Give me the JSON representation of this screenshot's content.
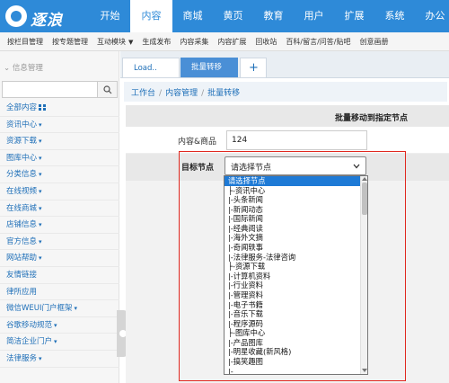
{
  "logo": {
    "text": "逐浪"
  },
  "topnav": [
    {
      "label": "开始"
    },
    {
      "label": "内容"
    },
    {
      "label": "商城"
    },
    {
      "label": "黄页"
    },
    {
      "label": "教育"
    },
    {
      "label": "用户"
    },
    {
      "label": "扩展"
    },
    {
      "label": "系统"
    },
    {
      "label": "办公"
    }
  ],
  "toolbar": [
    {
      "label": "按栏目管理"
    },
    {
      "label": "按专题管理"
    },
    {
      "label": "互动模块"
    },
    {
      "label": "生成发布"
    },
    {
      "label": "内容采集"
    },
    {
      "label": "内容扩展"
    },
    {
      "label": "回收站"
    },
    {
      "label": "百科/留言/问答/贴吧"
    },
    {
      "label": "创意画册"
    }
  ],
  "sidebar": {
    "title": "信息管理",
    "search_placeholder": "",
    "items": [
      {
        "label": "全部内容"
      },
      {
        "label": "资讯中心"
      },
      {
        "label": "资源下载"
      },
      {
        "label": "图库中心"
      },
      {
        "label": "分类信息"
      },
      {
        "label": "在线视频"
      },
      {
        "label": "在线商城"
      },
      {
        "label": "店铺信息"
      },
      {
        "label": "官方信息"
      },
      {
        "label": "网站帮助"
      },
      {
        "label": "友情链接"
      },
      {
        "label": "律所应用"
      },
      {
        "label": "微信WEUI门户框架"
      },
      {
        "label": "谷歌移动规范"
      },
      {
        "label": "简洁企业门户"
      },
      {
        "label": "法律服务"
      }
    ]
  },
  "tabs": [
    {
      "label": "Load.."
    },
    {
      "label": "批量转移"
    },
    {
      "label": "+"
    }
  ],
  "breadcrumb": [
    "工作台",
    "内容管理",
    "批量转移"
  ],
  "form": {
    "header": "批量移动到指定节点",
    "content_label": "内容&商品",
    "content_value": "124",
    "target_label": "目标节点",
    "select_value": "请选择节点"
  },
  "dropdown_options": [
    "请选择节点",
    "├-资讯中心",
    "  |-头条新闻",
    "  |-新闻动态",
    "  |-国际新闻",
    "  |-经典阅读",
    "  |-海外文摘",
    "  |-奇闻轶事",
    "  |-法律服务-法律咨询",
    "├-资源下载",
    "  |-计算机资料",
    "  |-行业资料",
    "  |-管理资料",
    "  |-电子书籍",
    "  |-音乐下载",
    "  |-程序源码",
    "├-图库中心",
    "  |-产品图库",
    "  |-明星收藏(新风格)",
    "  |-搞笑趣图",
    "  |-"
  ]
}
